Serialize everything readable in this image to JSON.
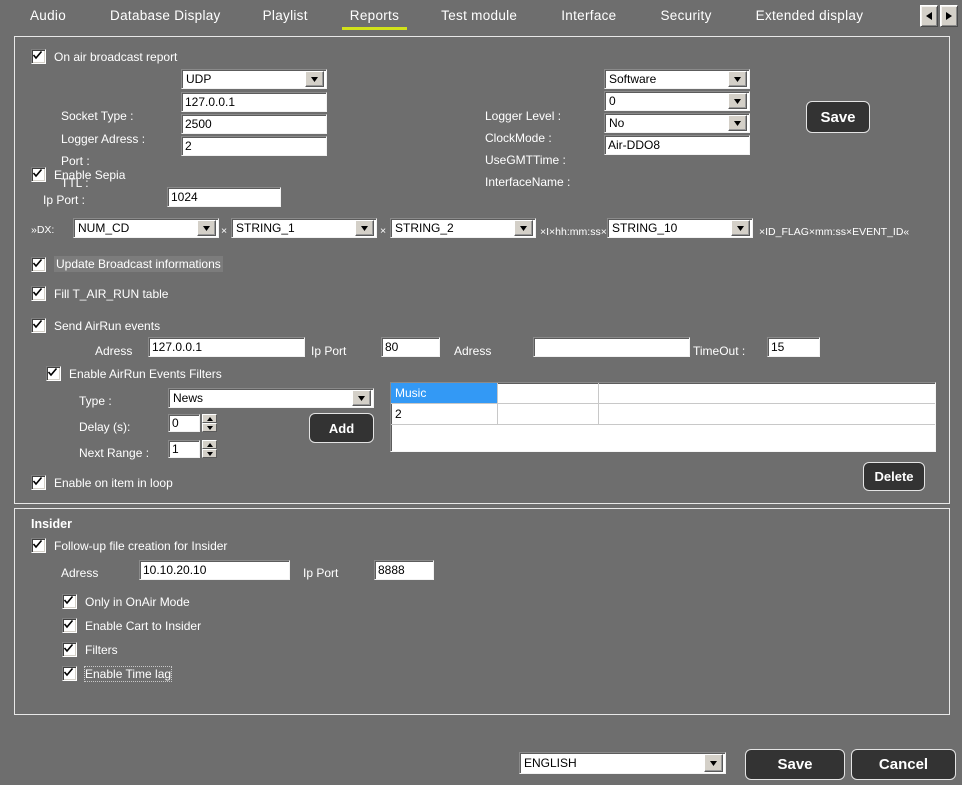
{
  "tabs": [
    {
      "label": "Audio",
      "active": false
    },
    {
      "label": "Database",
      "active": false
    },
    {
      "label": "Display",
      "active": false
    },
    {
      "label": "Playlist",
      "active": false
    },
    {
      "label": "Reports",
      "active": true
    },
    {
      "label": "Test module",
      "active": false
    },
    {
      "label": "Interface",
      "active": false
    },
    {
      "label": "Security",
      "active": false
    },
    {
      "label": "Extended display",
      "active": false
    }
  ],
  "nav": {
    "prev_icon": "left-arrow-icon",
    "next_icon": "right-arrow-icon"
  },
  "accent_color": "#d2e21a",
  "selection_color": "#3399f5",
  "broadcast": {
    "onair_report": {
      "label": "On air broadcast report",
      "checked": true
    },
    "socket_type": {
      "label": "Socket Type :",
      "value": "UDP"
    },
    "logger_address": {
      "label": "Logger Adress :",
      "value": "127.0.0.1"
    },
    "port": {
      "label": "Port :",
      "value": "2500"
    },
    "ttl": {
      "label": "TTL :",
      "value": "2"
    },
    "logger_level": {
      "label": "Logger Level :",
      "value": "Software"
    },
    "clock_mode": {
      "label": "ClockMode :",
      "value": "0"
    },
    "use_gmt_time": {
      "label": "UseGMTTime :",
      "value": "No"
    },
    "interface_name": {
      "label": "InterfaceName :",
      "value": "Air-DDO8"
    },
    "save_button": "Save",
    "enable_sepia": {
      "label": "Enable Sepia",
      "checked": true
    },
    "ip_port": {
      "label": "Ip Port :",
      "value": "1024"
    },
    "dx": {
      "prefix": "»DX:",
      "field1": "NUM_CD",
      "sep1": "×",
      "field2": "STRING_1",
      "sep2": "×",
      "field3": "STRING_2",
      "sep3": "×I×hh:mm:ss×",
      "field4": "STRING_10",
      "suffix": "×ID_FLAG×mm:ss×EVENT_ID«"
    },
    "update_broadcast": {
      "label": "Update Broadcast informations",
      "checked": true
    },
    "fill_table": {
      "label": "Fill T_AIR_RUN table",
      "checked": true
    },
    "send_airrun": {
      "label": "Send AirRun events",
      "checked": true
    },
    "airrun_address_label": "Adress",
    "airrun_address_value": "127.0.0.1",
    "airrun_ipport_label": "Ip Port",
    "airrun_ipport_value": "80",
    "airrun_address2_label": "Adress",
    "airrun_address2_value": "",
    "timeout_label": "TimeOut :",
    "timeout_value": "15",
    "enable_filters": {
      "label": "Enable AirRun Events Filters",
      "checked": true
    },
    "type": {
      "label": "Type :",
      "value": "News"
    },
    "delay": {
      "label": "Delay (s):",
      "value": "0"
    },
    "next_range": {
      "label": "Next Range :",
      "value": "1"
    },
    "add_button": "Add",
    "delete_button": "Delete",
    "enable_loop": {
      "label": "Enable on item in loop",
      "checked": true
    },
    "filter_rows": [
      {
        "cells": [
          "Music",
          "",
          ""
        ],
        "selected_index": 0
      },
      {
        "cells": [
          "2",
          "",
          ""
        ],
        "selected_index": -1
      }
    ]
  },
  "insider": {
    "title": "Insider",
    "followup": {
      "label": "Follow-up file creation for Insider",
      "checked": true
    },
    "address_label": "Adress",
    "address_value": "10.10.20.10",
    "ipport_label": "Ip Port",
    "ipport_value": "8888",
    "options": [
      {
        "label": "Only in OnAir Mode",
        "checked": true,
        "focused": false
      },
      {
        "label": "Enable Cart to Insider",
        "checked": true,
        "focused": false
      },
      {
        "label": "Filters",
        "checked": true,
        "focused": false
      },
      {
        "label": "Enable Time lag",
        "checked": true,
        "focused": true
      }
    ]
  },
  "footer": {
    "language": "ENGLISH",
    "save_label": "Save",
    "cancel_label": "Cancel"
  }
}
